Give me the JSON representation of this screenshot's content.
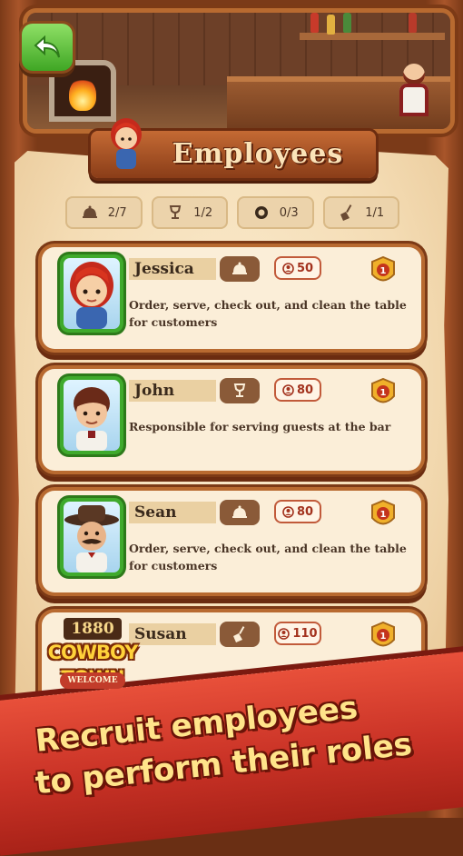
{
  "screen": {
    "title": "Employees"
  },
  "stats": [
    {
      "icon": "serving-bell-icon",
      "value": "2/7"
    },
    {
      "icon": "goblet-icon",
      "value": "1/2"
    },
    {
      "icon": "pan-icon",
      "value": "0/3"
    },
    {
      "icon": "broom-icon",
      "value": "1/1"
    }
  ],
  "employees": [
    {
      "name": "Jessica",
      "role_icon": "serving-bell-icon",
      "cost": "50",
      "level": "1",
      "description": "Order, serve, check out, and clean the table for customers"
    },
    {
      "name": "John",
      "role_icon": "goblet-icon",
      "cost": "80",
      "level": "1",
      "description": "Responsible for serving guests at the bar"
    },
    {
      "name": "Sean",
      "role_icon": "serving-bell-icon",
      "cost": "80",
      "level": "1",
      "description": "Order, serve, check out, and clean the table for customers"
    },
    {
      "name": "Susan",
      "role_icon": "broom-icon",
      "cost": "110",
      "level": "1",
      "description": ""
    }
  ],
  "logo": {
    "year": "1880",
    "name": "COWBOY TOWN",
    "tagline": "WELCOME"
  },
  "promo": {
    "line1": "Recruit employees",
    "line2": "to perform their roles"
  },
  "colors": {
    "accent_green": "#3fa624",
    "banner_red": "#c93226",
    "slogan_yellow": "#ffe48a"
  }
}
